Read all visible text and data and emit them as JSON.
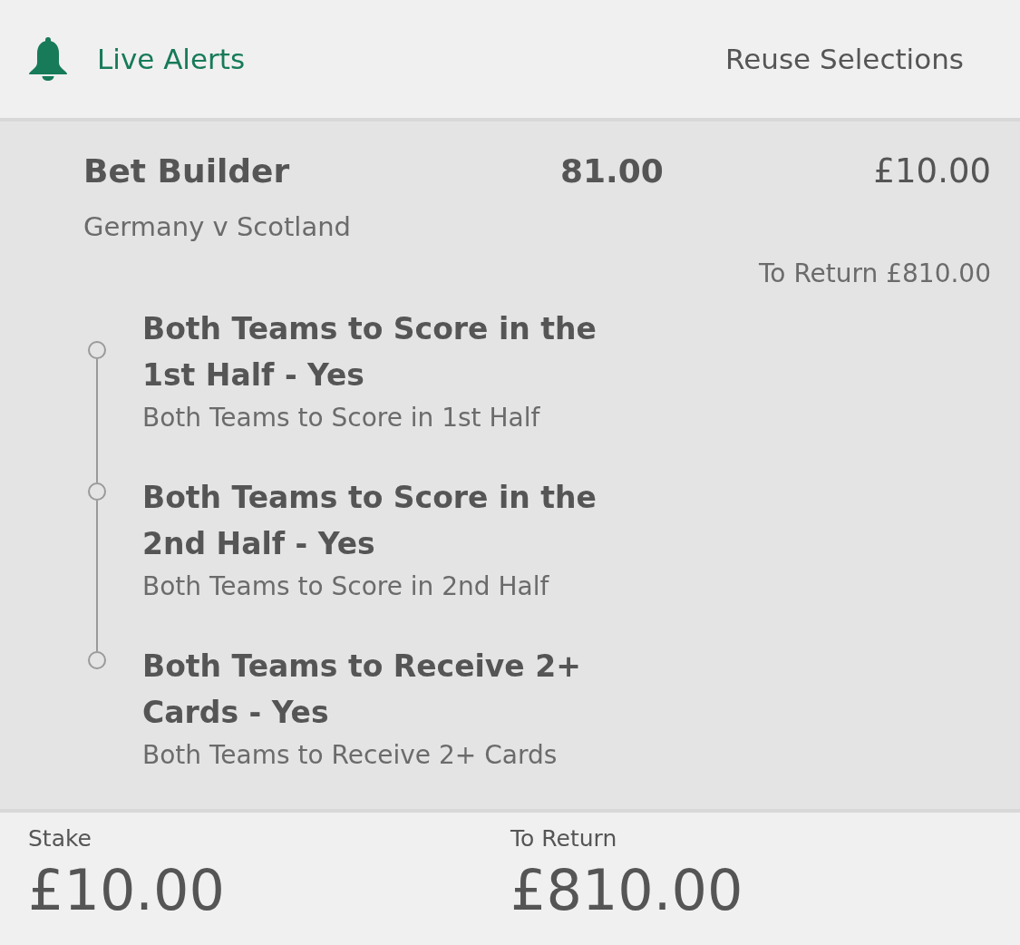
{
  "header": {
    "alerts_button": "Live Alerts",
    "reuse_button": "Reuse Selections"
  },
  "bet": {
    "title": "Bet Builder",
    "odds": "81.00",
    "stake": "£10.00",
    "event": "Germany v Scotland",
    "to_return": "To Return £810.00",
    "legs": [
      {
        "selection": "Both Teams to Score in the 1st Half - Yes",
        "market": "Both Teams to Score in 1st Half"
      },
      {
        "selection": "Both Teams to Score in the 2nd Half - Yes",
        "market": "Both Teams to Score in 2nd Half"
      },
      {
        "selection": "Both Teams to Receive 2+ Cards - Yes",
        "market": "Both Teams to Receive 2+ Cards"
      }
    ]
  },
  "footer": {
    "stake_label": "Stake",
    "stake_value": "£10.00",
    "return_label": "To Return",
    "return_value": "£810.00"
  }
}
